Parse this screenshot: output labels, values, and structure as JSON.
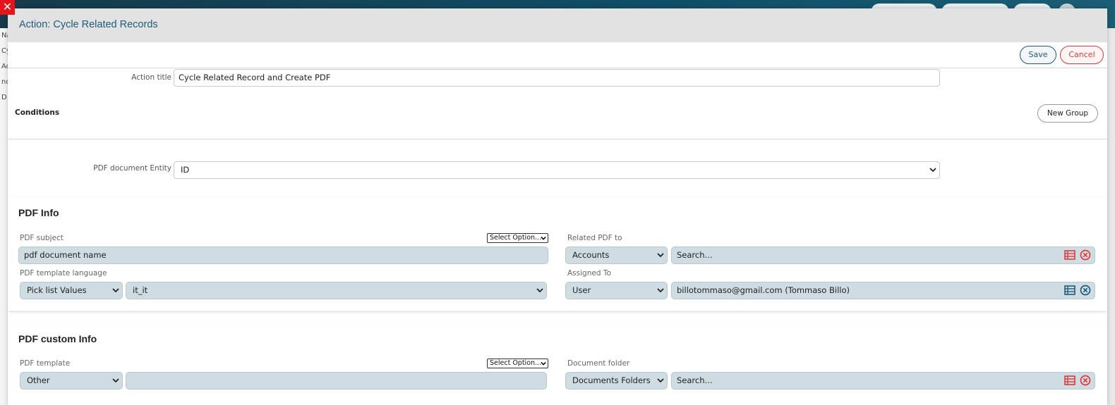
{
  "background": {
    "sidebar_fragments": [
      "Na",
      "Cy",
      "Ac",
      "nc",
      "D"
    ]
  },
  "modal": {
    "title": "Action: Cycle Related Records",
    "save_label": "Save",
    "cancel_label": "Cancel"
  },
  "action_title": {
    "label": "Action title",
    "value": "Cycle Related Record and Create PDF"
  },
  "conditions": {
    "title": "Conditions",
    "new_group_label": "New Group"
  },
  "pdf_entity": {
    "label": "PDF document Entity",
    "value": "ID"
  },
  "pdf_info": {
    "title": "PDF Info",
    "subject_label": "PDF subject",
    "subject_option": "Select Option...",
    "subject_value": "pdf document name",
    "related_label": "Related PDF to",
    "related_module": "Accounts",
    "related_placeholder": "Search...",
    "language_label": "PDF template language",
    "language_type": "Pick list Values",
    "language_value": "it_it",
    "assigned_label": "Assigned To",
    "assigned_type": "User",
    "assigned_value": "billotommaso@gmail.com (Tommaso Billo)"
  },
  "pdf_custom": {
    "title": "PDF custom Info",
    "template_label": "PDF template",
    "template_option": "Select Option...",
    "template_type": "Other",
    "template_value": "",
    "folder_label": "Document folder",
    "folder_module": "Documents Folders",
    "folder_placeholder": "Search..."
  },
  "colors": {
    "accent": "#1d5c7a",
    "danger": "#e03a3a",
    "input_fill": "#cfdde3"
  }
}
